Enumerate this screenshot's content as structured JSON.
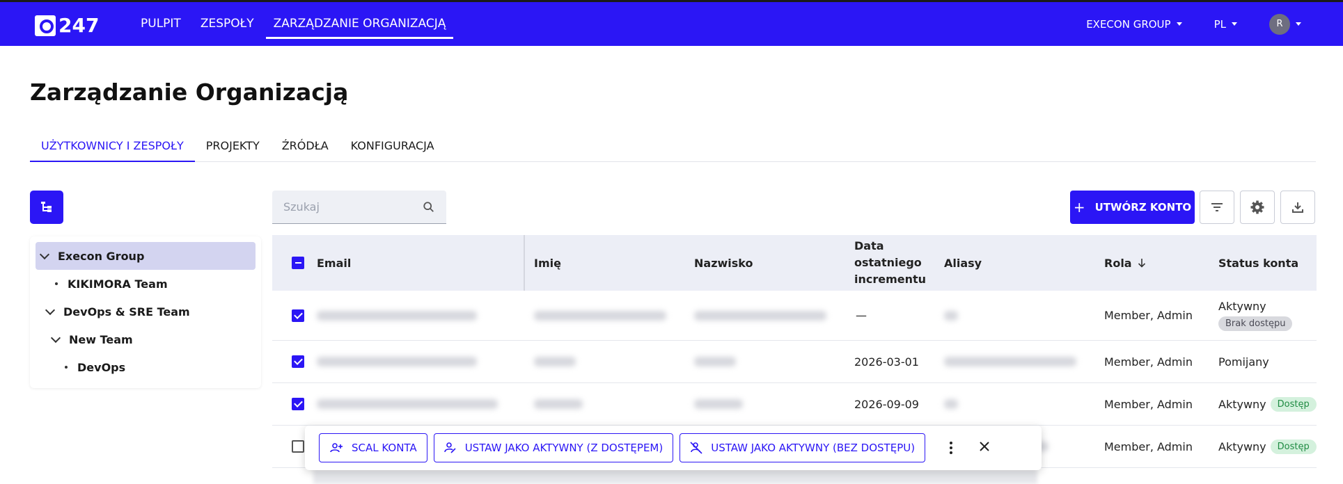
{
  "app": {
    "logo_text": "247",
    "brand_color": "#2b16f5"
  },
  "nav": {
    "items": [
      "PULPIT",
      "ZESPOŁY",
      "ZARZĄDZANIE ORGANIZACJĄ"
    ],
    "active": 2
  },
  "header_right": {
    "org": "EXECON GROUP",
    "lang": "PL",
    "avatar_initial": "R"
  },
  "page": {
    "title": "Zarządzanie Organizacją"
  },
  "tabs": {
    "items": [
      "UŻYTKOWNICY I ZESPOŁY",
      "PROJEKTY",
      "ŹRÓDŁA",
      "KONFIGURACJA"
    ],
    "active": 0
  },
  "tree": {
    "items": [
      {
        "label": "Execon Group",
        "kind": "expanded",
        "level": 0,
        "selected": true
      },
      {
        "label": "KIKIMORA Team",
        "kind": "leaf",
        "level": 1
      },
      {
        "label": "DevOps & SRE Team",
        "kind": "expanded",
        "level": 1
      },
      {
        "label": "New Team",
        "kind": "expanded",
        "level": 2
      },
      {
        "label": "DevOps",
        "kind": "leaf",
        "level": 3
      }
    ]
  },
  "toolbar": {
    "search_placeholder": "Szukaj",
    "create_label": "UTWÓRZ KONTO"
  },
  "table": {
    "headers": {
      "email": "Email",
      "first_name": "Imię",
      "last_name": "Nazwisko",
      "last_increment_l1": "Data",
      "last_increment_l2": "ostatniego",
      "last_increment_l3": "incrementu",
      "aliases": "Aliasy",
      "role": "Rola",
      "status": "Status konta"
    },
    "rows": [
      {
        "checked": true,
        "date": "—",
        "role": "Member, Admin",
        "status": "Aktywny",
        "badge": "Brak dostępu",
        "badge_type": "gray"
      },
      {
        "checked": true,
        "date": "2026-03-01",
        "role": "Member, Admin",
        "status": "Pomijany",
        "badge": "",
        "badge_type": ""
      },
      {
        "checked": true,
        "date": "2026-09-09",
        "role": "Member, Admin",
        "status": "Aktywny",
        "badge": "Dostęp",
        "badge_type": "green"
      },
      {
        "checked": false,
        "date": "",
        "role": "Member, Admin",
        "status": "Aktywny",
        "badge": "Dostęp",
        "badge_type": "green"
      }
    ]
  },
  "action_bar": {
    "merge": "SCAL KONTA",
    "set_active_access": "USTAW JAKO AKTYWNY (Z DOSTĘPEM)",
    "set_active_no_access": "USTAW JAKO AKTYWNY (BEZ DOSTĘPU)"
  }
}
